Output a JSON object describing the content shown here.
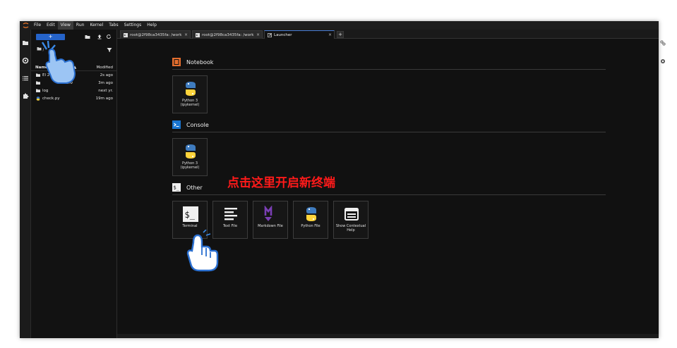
{
  "menubar": {
    "items": [
      "File",
      "Edit",
      "View",
      "Run",
      "Kernel",
      "Tabs",
      "Settings",
      "Help"
    ],
    "active": "View"
  },
  "filebrowser": {
    "new_button": "+",
    "path": "/",
    "header": {
      "name": "Name",
      "sort": "▲",
      "modified": "Modified"
    },
    "rows": [
      {
        "icon": "folder-icon",
        "name": "El 28...",
        "modified": "2s ago"
      },
      {
        "icon": "folder-icon",
        "name": "env",
        "modified": "3m ago"
      },
      {
        "icon": "folder-icon",
        "name": "log",
        "modified": "next yr."
      },
      {
        "icon": "python-file-icon",
        "name": "check.py",
        "modified": "19m ago"
      }
    ]
  },
  "tabs": [
    {
      "label": "root@2f98ca3435fa: /work",
      "icon": "terminal-icon"
    },
    {
      "label": "root@2f98ca3435fa: /work",
      "icon": "terminal-icon"
    },
    {
      "label": "Launcher",
      "icon": "launcher-icon",
      "active": true
    }
  ],
  "launcher": {
    "sections": [
      {
        "title": "Notebook",
        "icon": "notebook-icon",
        "color": "#e46e2e"
      },
      {
        "title": "Console",
        "icon": "console-icon",
        "color": "#1976d2"
      },
      {
        "title": "Other",
        "icon": "other-terminal-icon",
        "color": "#ffffff"
      }
    ],
    "notebook_cards": [
      {
        "label": "Python 3 (ipykernel)"
      }
    ],
    "console_cards": [
      {
        "label": "Python 3 (ipykernel)"
      }
    ],
    "other_cards": [
      {
        "label": "Terminal",
        "icon": "terminal-icon"
      },
      {
        "label": "Text File",
        "icon": "text-file-icon"
      },
      {
        "label": "Markdown File",
        "icon": "markdown-icon"
      },
      {
        "label": "Python File",
        "icon": "python-icon"
      },
      {
        "label": "Show Contextual Help",
        "icon": "contextual-help-icon"
      }
    ]
  },
  "annotation": "点击这里开启新终端",
  "colors": {
    "accent": "#2563c9",
    "annotation": "#ff1a1a",
    "background": "#111111"
  }
}
